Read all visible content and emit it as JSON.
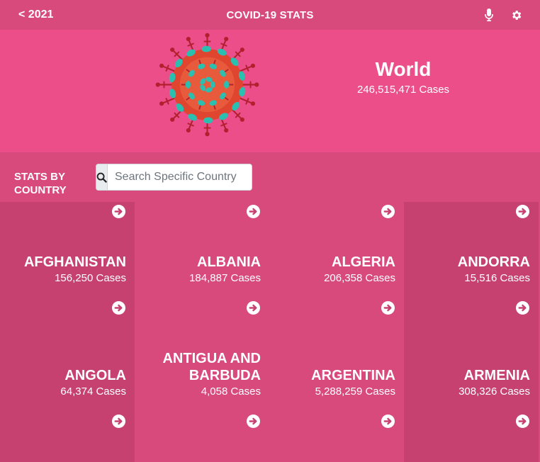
{
  "header": {
    "back_label": "< 2021",
    "title": "COVID-19 STATS",
    "icons": [
      "microphone-icon",
      "gear-icon"
    ]
  },
  "hero": {
    "name": "World",
    "cases": "246,515,471 Cases"
  },
  "search": {
    "section_label": "STATS BY COUNTRY",
    "placeholder": "Search Specific Country",
    "value": ""
  },
  "countries": [
    {
      "name": "AFGHANISTAN",
      "cases": "156,250 Cases"
    },
    {
      "name": "ALBANIA",
      "cases": "184,887 Cases"
    },
    {
      "name": "ALGERIA",
      "cases": "206,358 Cases"
    },
    {
      "name": "ANDORRA",
      "cases": "15,516 Cases"
    },
    {
      "name": "ANGOLA",
      "cases": "64,374 Cases"
    },
    {
      "name": "ANTIGUA AND BARBUDA",
      "cases": "4,058 Cases"
    },
    {
      "name": "ARGENTINA",
      "cases": "5,288,259 Cases"
    },
    {
      "name": "ARMENIA",
      "cases": "308,326 Cases"
    }
  ],
  "colors": {
    "header_bg": "#d94a7c",
    "hero_bg": "#ec4e8a",
    "card_dark": "#c74170",
    "card_mid": "#d94a7c",
    "virus_body": "#e0452f",
    "virus_spike": "#2bbfb0",
    "virus_stalk": "#b2202f"
  }
}
